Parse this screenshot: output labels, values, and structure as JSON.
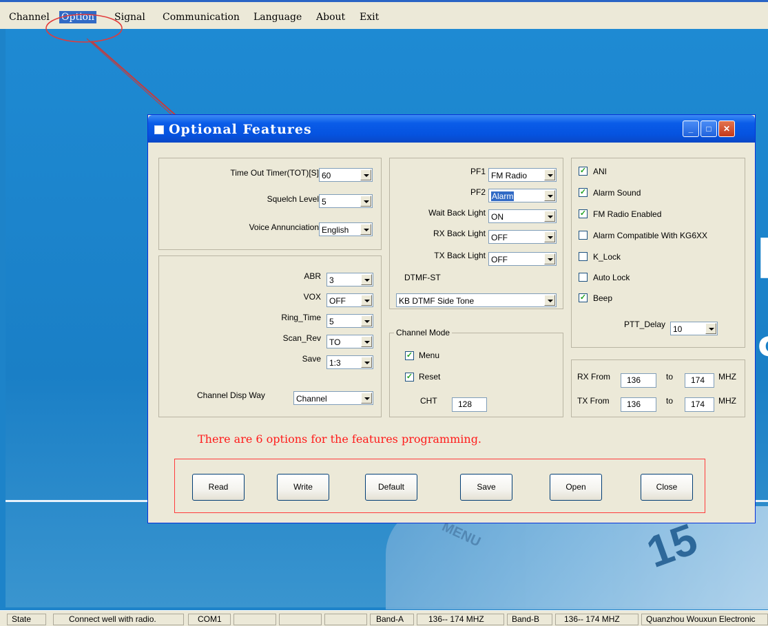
{
  "menubar": {
    "items": [
      "Channel",
      "Option",
      "Signal",
      "Communication",
      "Language",
      "About",
      "Exit"
    ]
  },
  "window": {
    "title": "Optional Features"
  },
  "left_top": {
    "tot": {
      "label": "Time Out Timer(TOT)[S]",
      "value": "60"
    },
    "squelch": {
      "label": "Squelch Level",
      "value": "5"
    },
    "voice": {
      "label": "Voice Annunciation",
      "value": "English"
    }
  },
  "left_bottom": {
    "abr": {
      "label": "ABR",
      "value": "3"
    },
    "vox": {
      "label": "VOX",
      "value": "OFF"
    },
    "ring": {
      "label": "Ring_Time",
      "value": "5"
    },
    "scan": {
      "label": "Scan_Rev",
      "value": "TO"
    },
    "save": {
      "label": "Save",
      "value": "1:3"
    },
    "disp": {
      "label": "Channel Disp Way",
      "value": "Channel"
    }
  },
  "mid_top": {
    "pf1": {
      "label": "PF1",
      "value": "FM Radio"
    },
    "pf2": {
      "label": "PF2",
      "value": "Alarm"
    },
    "wait": {
      "label": "Wait Back Light",
      "value": "ON"
    },
    "rx": {
      "label": "RX Back Light",
      "value": "OFF"
    },
    "tx": {
      "label": "TX Back Light",
      "value": "OFF"
    },
    "dtmf_label": "DTMF-ST",
    "dtmf_value": "KB DTMF Side Tone"
  },
  "channel_mode": {
    "legend": "Channel Mode",
    "menu": "Menu",
    "reset": "Reset",
    "cht_label": "CHT",
    "cht_value": "128"
  },
  "right_checks": {
    "ani": "ANI",
    "alarm_sound": "Alarm Sound",
    "fm": "FM Radio Enabled",
    "kg6": "Alarm Compatible With KG6XX",
    "klock": "K_Lock",
    "autolock": "Auto Lock",
    "beep": "Beep"
  },
  "ptt": {
    "label": "PTT_Delay",
    "value": "10"
  },
  "freq": {
    "rx_label": "RX From",
    "rx_from": "136",
    "rx_to": "174",
    "tx_label": "TX From",
    "tx_from": "136",
    "tx_to": "174",
    "to": "to",
    "unit": "MHZ"
  },
  "annotation": "There are 6 options for the features programming.",
  "buttons": {
    "read": "Read",
    "write": "Write",
    "default": "Default",
    "save": "Save",
    "open": "Open",
    "close": "Close"
  },
  "statusbar": {
    "state": "State",
    "msg": "Connect well with radio.",
    "port": "COM1",
    "band_a": "Band-A",
    "range_a": "136-- 174 MHZ",
    "band_b": "Band-B",
    "range_b": "136-- 174 MHZ",
    "company": "Quanzhou Wouxun Electronic"
  }
}
